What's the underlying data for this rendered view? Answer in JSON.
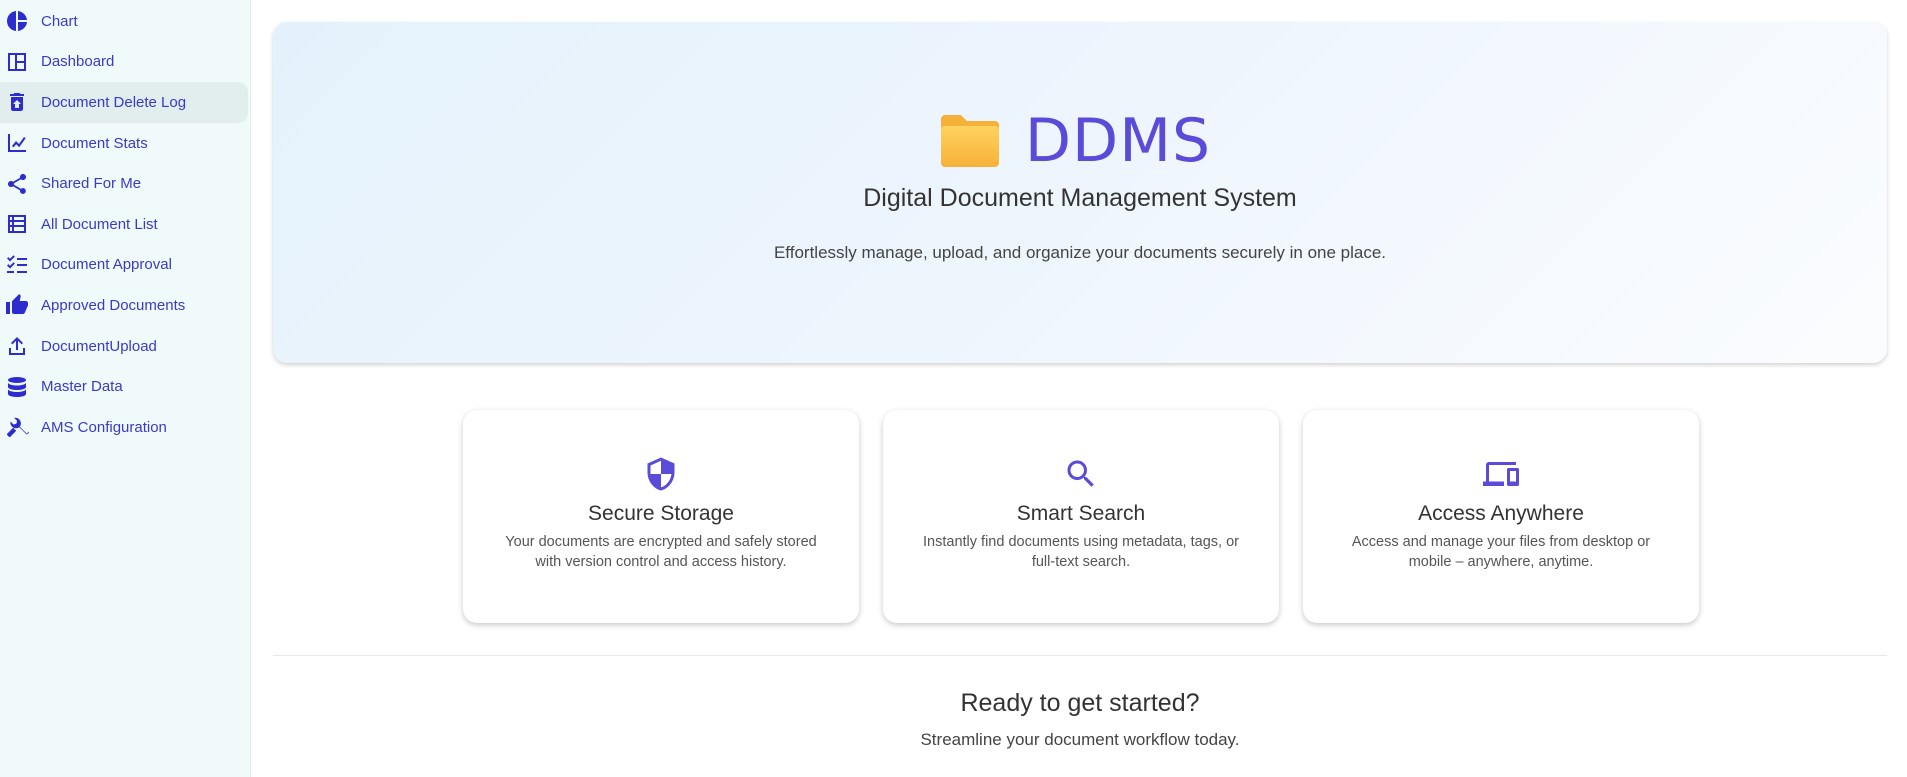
{
  "sidebar": {
    "items": [
      {
        "label": "Chart",
        "icon": "pie-chart-icon"
      },
      {
        "label": "Dashboard",
        "icon": "dashboard-icon"
      },
      {
        "label": "Document Delete Log",
        "icon": "restore-delete-icon",
        "active": true
      },
      {
        "label": "Document Stats",
        "icon": "line-chart-icon"
      },
      {
        "label": "Shared For Me",
        "icon": "share-icon"
      },
      {
        "label": "All Document List",
        "icon": "list-icon"
      },
      {
        "label": "Document Approval",
        "icon": "checklist-icon"
      },
      {
        "label": "Approved Documents",
        "icon": "thumbs-up-icon"
      },
      {
        "label": "DocumentUpload",
        "icon": "upload-icon"
      },
      {
        "label": "Master Data",
        "icon": "database-icon"
      },
      {
        "label": "AMS Configuration",
        "icon": "tools-icon"
      }
    ]
  },
  "hero": {
    "title": "DDMS",
    "subtitle": "Digital Document Management System",
    "description": "Effortlessly manage, upload, and organize your documents securely in one place.",
    "icon": "folder-icon"
  },
  "features": [
    {
      "title": "Secure Storage",
      "text": "Your documents are encrypted and safely stored with version control and access history.",
      "icon": "shield-icon"
    },
    {
      "title": "Smart Search",
      "text": "Instantly find documents using metadata, tags, or full-text search.",
      "icon": "search-icon"
    },
    {
      "title": "Access Anywhere",
      "text": "Access and manage your files from desktop or mobile – anywhere, anytime.",
      "icon": "devices-icon"
    }
  ],
  "cta": {
    "title": "Ready to get started?",
    "subtitle": "Streamline your document workflow today."
  },
  "colors": {
    "accent": "#5a4bd8",
    "sidebar_text": "#3b39c8",
    "sidebar_bg": "#f0fafb",
    "active_bg": "#e2eded"
  }
}
